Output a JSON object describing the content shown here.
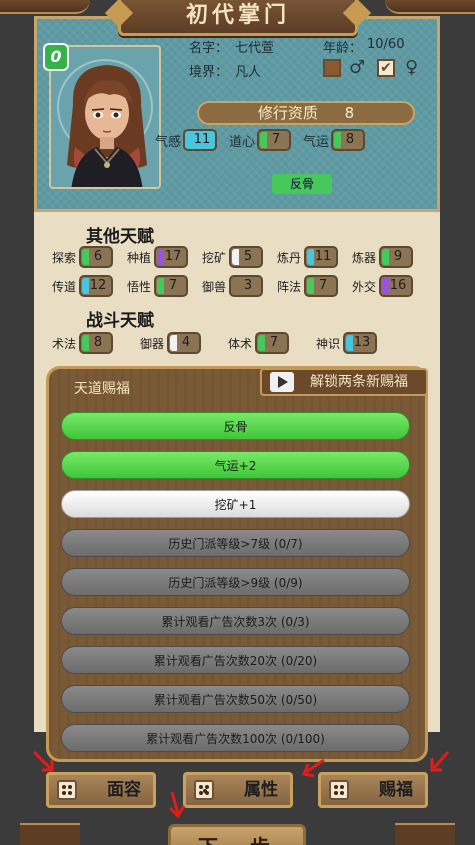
{
  "header": {
    "title": "初代掌门"
  },
  "profile": {
    "name_label": "名字：",
    "name_value": "七代萱",
    "age_label": "年龄：",
    "age_value": "10/60",
    "realm_label": "境界：",
    "realm_value": "凡人",
    "male_symbol": "♂",
    "female_symbol": "♀",
    "check_mark": "✔",
    "badge": "0",
    "aptitude_label": "修行资质",
    "aptitude_value": "8",
    "stats": [
      {
        "label": "气感",
        "value": "11"
      },
      {
        "label": "道心",
        "value": "7"
      },
      {
        "label": "气运",
        "value": "8"
      }
    ],
    "trait_tag": "反骨"
  },
  "other_talents": {
    "title": "其他天赋",
    "rows": [
      [
        {
          "label": "探索",
          "value": "6"
        },
        {
          "label": "种植",
          "value": "17"
        },
        {
          "label": "挖矿",
          "value": "5"
        },
        {
          "label": "炼丹",
          "value": "11"
        },
        {
          "label": "炼器",
          "value": "9"
        }
      ],
      [
        {
          "label": "传道",
          "value": "12"
        },
        {
          "label": "悟性",
          "value": "7"
        },
        {
          "label": "御兽",
          "value": "3"
        },
        {
          "label": "阵法",
          "value": "7"
        },
        {
          "label": "外交",
          "value": "16"
        }
      ]
    ]
  },
  "combat_talents": {
    "title": "战斗天赋",
    "items": [
      {
        "label": "术法",
        "value": "8"
      },
      {
        "label": "御器",
        "value": "4"
      },
      {
        "label": "体术",
        "value": "7"
      },
      {
        "label": "神识",
        "value": "13"
      }
    ]
  },
  "blessings": {
    "title": "天道赐福",
    "unlock_label": "解锁两条新赐福",
    "items": [
      {
        "label": "反骨",
        "state": "green"
      },
      {
        "label": "气运+2",
        "state": "green"
      },
      {
        "label": "挖矿+1",
        "state": "white"
      },
      {
        "label": "历史门派等级>7级 (0/7)",
        "state": "locked"
      },
      {
        "label": "历史门派等级>9级 (0/9)",
        "state": "locked"
      },
      {
        "label": "累计观看广告次数3次 (0/3)",
        "state": "locked"
      },
      {
        "label": "累计观看广告次数20次 (0/20)",
        "state": "locked"
      },
      {
        "label": "累计观看广告次数50次 (0/50)",
        "state": "locked"
      },
      {
        "label": "累计观看广告次数100次 (0/100)",
        "state": "locked"
      }
    ]
  },
  "bottom_buttons": {
    "face": "面容",
    "attributes": "属性",
    "blessing": "赐福",
    "next": "下一步"
  },
  "colors": {
    "accent_green": "#47c85a",
    "accent_blue": "#49c5de",
    "accent_purple": "#9a55d6",
    "frame_gold": "#c49a58",
    "panel_teal": "#5f9aa3",
    "parchment": "#e9dec3",
    "annotation_arrow": "#e21b1b"
  }
}
